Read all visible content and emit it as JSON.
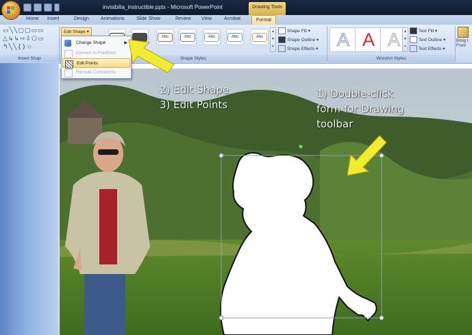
{
  "titlebar": {
    "window_title": "invisibilia_instructible.pptx - Microsoft PowerPoint",
    "contextual_tab_group": "Drawing Tools"
  },
  "tabs": [
    {
      "label": "Home"
    },
    {
      "label": "Insert"
    },
    {
      "label": "Design"
    },
    {
      "label": "Animations"
    },
    {
      "label": "Slide Show"
    },
    {
      "label": "Review"
    },
    {
      "label": "View"
    },
    {
      "label": "Acrobat"
    },
    {
      "label": "Format",
      "active": true
    }
  ],
  "ribbon": {
    "groups": {
      "insert_shapes": "Insert Shap",
      "shape_styles": "Shape Styles",
      "wordart_styles": "WordArt Styles"
    },
    "edit_shape_label": "Edit Shape",
    "style_gallery_label": "Abc",
    "shape_fill": "Shape Fill",
    "shape_outline": "Shape Outline",
    "shape_effects": "Shape Effects",
    "text_fill": "Text Fill",
    "text_outline": "Text Outline",
    "text_effects": "Text Effects",
    "wordart_sample": "A",
    "bring_to_front": [
      "Bring t",
      "Front"
    ]
  },
  "edit_shape_menu": {
    "items": [
      {
        "label": "Change Shape",
        "has_submenu": true,
        "disabled": false
      },
      {
        "label": "Convert to Freeform",
        "disabled": true
      },
      {
        "label": "Edit Points",
        "disabled": false,
        "highlighted": true
      },
      {
        "label": "Reroute Connectors",
        "disabled": true
      }
    ]
  },
  "slide": {
    "annotation_left": [
      "2) Edit Shape",
      "3) Edit Points"
    ],
    "annotation_right": [
      "1) Double-click",
      "form for Drawing",
      "toolbar"
    ]
  },
  "colors": {
    "arrow": "#f2ec2e",
    "ribbon": "#d3e1f4",
    "titlebar": "#1b2a44",
    "drawing_tools_tab": "#d8b04a"
  }
}
